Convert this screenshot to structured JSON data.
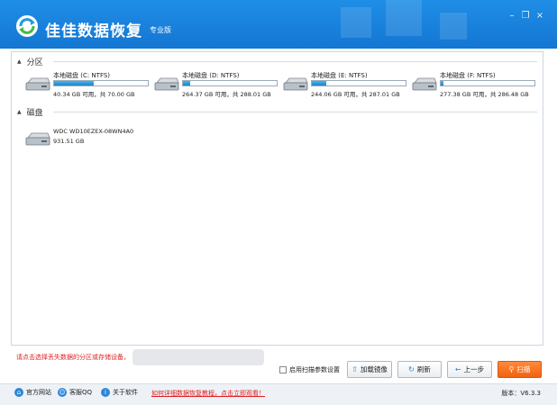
{
  "titlebar": {
    "app_name": "佳佳数据恢复",
    "edition": "专业版",
    "minimize_label": "–",
    "restore_label": "❐",
    "close_label": "×"
  },
  "sections": {
    "partitions_title": "分区",
    "disks_title": "磁盘"
  },
  "partitions": [
    {
      "name": "本地磁盘 (C: NTFS)",
      "stat": "40.34 GB 可用，共 70.00 GB",
      "used_fraction": 0.42
    },
    {
      "name": "本地磁盘 (D: NTFS)",
      "stat": "264.37 GB 可用，共 288.01 GB",
      "used_fraction": 0.08
    },
    {
      "name": "本地磁盘 (E: NTFS)",
      "stat": "244.06 GB 可用，共 287.01 GB",
      "used_fraction": 0.15
    },
    {
      "name": "本地磁盘 (F: NTFS)",
      "stat": "277.38 GB 可用，共 286.48 GB",
      "used_fraction": 0.03
    }
  ],
  "disks": [
    {
      "name": "WDC WD10EZEX-08WN4A0",
      "size": "931.51 GB"
    }
  ],
  "hint": "请点击选择丢失数据的分区或存储设备，",
  "options": {
    "enable_params_label": "启用扫描参数设置"
  },
  "buttons": {
    "load_image": "加载镜像",
    "refresh": "刷新",
    "prev": "上一步",
    "scan": "扫描"
  },
  "footer": {
    "website": "官方网站",
    "qq": "客服QQ",
    "about": "关于软件",
    "promo": "如何详细数据恢复教程，点击立即观看！",
    "version": "版本：V6.3.3"
  },
  "colors": {
    "titlebar": "#1680d8",
    "accent_orange": "#f06210",
    "hint_red": "#e02020"
  }
}
